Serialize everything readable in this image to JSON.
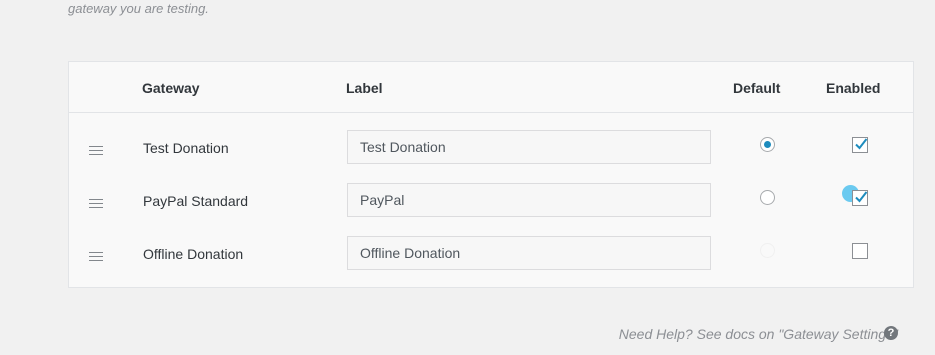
{
  "intro_text": "gateway you are testing.",
  "table": {
    "headers": {
      "gateway": "Gateway",
      "label": "Label",
      "default": "Default",
      "enabled": "Enabled"
    },
    "rows": [
      {
        "gateway": "Test Donation",
        "label": "Test Donation",
        "default": true,
        "enabled": true
      },
      {
        "gateway": "PayPal Standard",
        "label": "PayPal",
        "default": false,
        "enabled": true
      },
      {
        "gateway": "Offline Donation",
        "label": "Offline Donation",
        "default": false,
        "enabled": false
      }
    ]
  },
  "help": {
    "text": "Need Help? See docs on \"Gateway Settings\"",
    "icon": "question-icon",
    "icon_glyph": "?"
  },
  "colors": {
    "accent": "#1e8cbe",
    "cursor_highlight": "#5bc4ee"
  }
}
